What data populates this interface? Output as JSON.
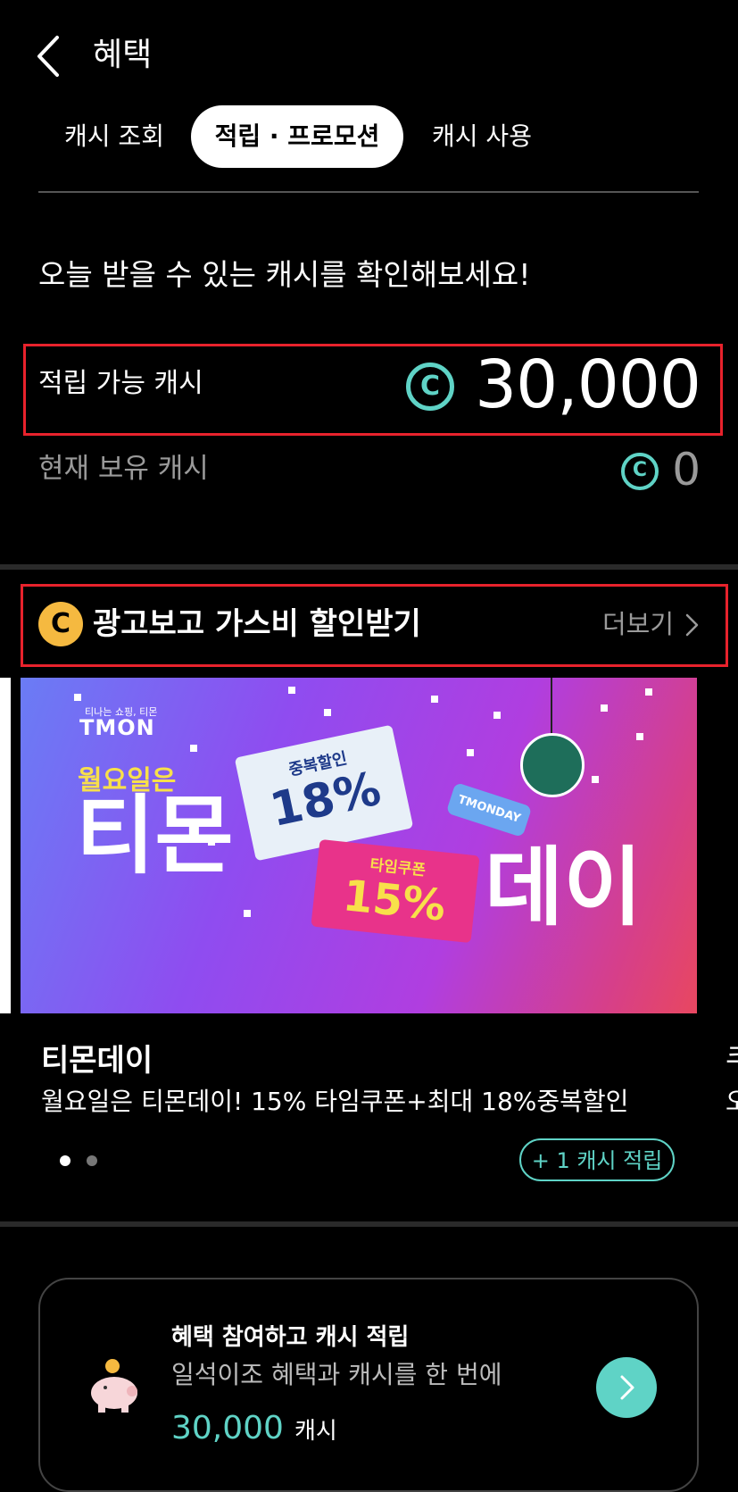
{
  "header": {
    "title": "혜택"
  },
  "tabs": [
    {
      "label": "캐시 조회"
    },
    {
      "label": "적립 · 프로모션"
    },
    {
      "label": "캐시 사용"
    }
  ],
  "headline": "오늘 받을 수 있는 캐시를 확인해보세요!",
  "cash": {
    "available_label": "적립 가능 캐시",
    "available_amount": "30,000",
    "hold_label": "현재 보유 캐시",
    "hold_amount": "0",
    "icon_char": "C"
  },
  "ad_section": {
    "icon_char": "C",
    "title": "광고보고 가스비 할인받기",
    "more_label": "더보기"
  },
  "banner": {
    "brand_small": "티나는 쇼핑, 티몬",
    "brand": "TMON",
    "monday": "월요일은",
    "timon": "티몬",
    "day": "데이",
    "ticket1_label": "중복할인",
    "ticket1_value": "18%",
    "ticket2_label": "타임쿠폰",
    "ticket2_value": "15%",
    "tag": "TMONDAY"
  },
  "card": {
    "title": "티몬데이",
    "description": "월요일은 티몬데이! 15% 타임쿠폰+최대 18%중복할인",
    "earn_button": "+ 1 캐시 적립",
    "next_title_peek": "쿠",
    "next_desc_peek": "오"
  },
  "bottom_card": {
    "title": "혜택 참여하고 캐시 적립",
    "subtitle": "일석이조 혜택과 캐시를 한 번에",
    "amount": "30,000",
    "unit": "캐시"
  },
  "colors": {
    "accent": "#5fd3c6",
    "highlight": "#e8222c",
    "coin": "#f5b940"
  }
}
